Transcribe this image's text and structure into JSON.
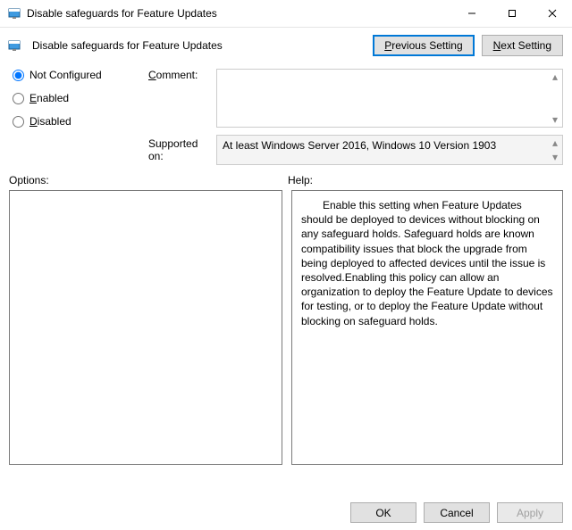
{
  "window": {
    "title": "Disable safeguards for Feature Updates"
  },
  "subheader": {
    "title": "Disable safeguards for Feature Updates"
  },
  "buttons": {
    "previous_p": "P",
    "previous_rest": "revious Setting",
    "next_n": "N",
    "next_rest": "ext Setting",
    "ok": "OK",
    "cancel": "Cancel",
    "apply": "Apply"
  },
  "radios": {
    "not_configured_n": "N",
    "not_configured_rest": "ot Configured",
    "enabled_e": "E",
    "enabled_rest": "nabled",
    "disabled_d": "D",
    "disabled_rest": "isabled"
  },
  "labels": {
    "comment_c": "C",
    "comment_rest": "omment:",
    "supported": "Supported on:",
    "options": "Options:",
    "help": "Help:"
  },
  "fields": {
    "comment": "",
    "supported_on": "At least Windows Server 2016, Windows 10 Version 1903"
  },
  "help_text": "Enable this setting when Feature Updates should be deployed to devices without blocking on any safeguard holds. Safeguard holds are known compatibility issues that block the upgrade from being deployed to affected devices until the issue is resolved.Enabling this policy can allow an organization to deploy the Feature Update to devices for testing, or to deploy the Feature Update without blocking on safeguard holds."
}
